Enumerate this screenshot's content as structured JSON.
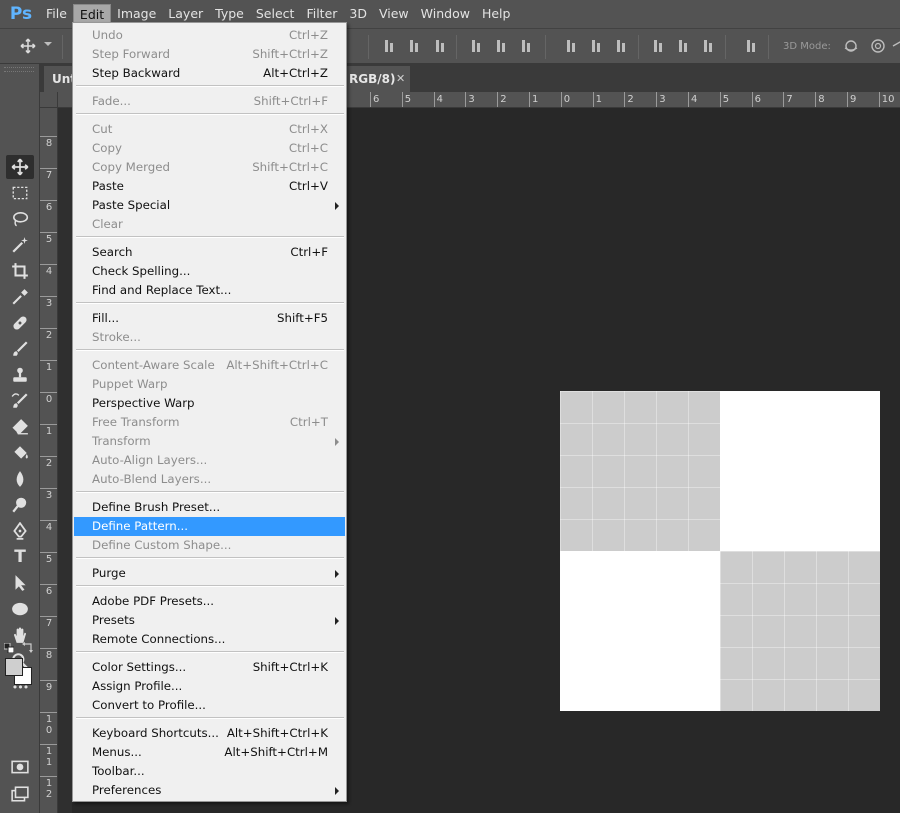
{
  "app": {
    "logo": "Ps"
  },
  "menubar": {
    "items": [
      "File",
      "Edit",
      "Image",
      "Layer",
      "Type",
      "Select",
      "Filter",
      "3D",
      "View",
      "Window",
      "Help"
    ],
    "active": "Edit"
  },
  "optionsbar": {
    "mode_3d_label": "3D Mode:",
    "icons": [
      "move-icon",
      "align-top-icon",
      "align-middle-icon",
      "align-bottom-icon",
      "align-left-icon",
      "align-center-icon",
      "align-right-icon",
      "distribute-icon",
      "3d-orbit-icon"
    ]
  },
  "document_tab": {
    "title_start": "Unt",
    "title_end": "RGB/8)",
    "close_glyph": "✕"
  },
  "rulers": {
    "top_ticks": [
      "6",
      "5",
      "4",
      "3",
      "2",
      "1",
      "0",
      "1",
      "2",
      "3",
      "4",
      "5",
      "6",
      "7",
      "8",
      "9",
      "10"
    ],
    "left_ticks": [
      "8",
      "7",
      "6",
      "5",
      "4",
      "3",
      "2",
      "1",
      "0",
      "1",
      "2",
      "3",
      "4",
      "5",
      "6",
      "7",
      "8",
      "9",
      "1\n0",
      "1\n1",
      "1\n2"
    ]
  },
  "toolbar": {
    "tools": [
      "move-tool",
      "marquee-tool",
      "lasso-tool",
      "magic-wand-tool",
      "crop-tool",
      "eyedropper-tool",
      "healing-brush-tool",
      "brush-tool",
      "clone-stamp-tool",
      "history-brush-tool",
      "eraser-tool",
      "paint-bucket-tool",
      "blur-tool",
      "dodge-tool",
      "pen-tool",
      "type-tool",
      "path-selection-tool",
      "ellipse-tool",
      "hand-tool",
      "zoom-tool",
      "more-tools",
      "quick-mask",
      "screen-mode"
    ],
    "type_glyph": "T",
    "more_glyph": "•••",
    "foreground_color": "#cfcfcf",
    "background_color": "#ffffff"
  },
  "edit_menu": {
    "groups": [
      [
        {
          "label": "Undo",
          "shortcut": "Ctrl+Z",
          "enabled": false
        },
        {
          "label": "Step Forward",
          "shortcut": "Shift+Ctrl+Z",
          "enabled": false
        },
        {
          "label": "Step Backward",
          "shortcut": "Alt+Ctrl+Z",
          "enabled": true
        }
      ],
      [
        {
          "label": "Fade...",
          "shortcut": "Shift+Ctrl+F",
          "enabled": false
        }
      ],
      [
        {
          "label": "Cut",
          "shortcut": "Ctrl+X",
          "enabled": false
        },
        {
          "label": "Copy",
          "shortcut": "Ctrl+C",
          "enabled": false
        },
        {
          "label": "Copy Merged",
          "shortcut": "Shift+Ctrl+C",
          "enabled": false
        },
        {
          "label": "Paste",
          "shortcut": "Ctrl+V",
          "enabled": true
        },
        {
          "label": "Paste Special",
          "shortcut": "",
          "enabled": true,
          "submenu": true
        },
        {
          "label": "Clear",
          "shortcut": "",
          "enabled": false
        }
      ],
      [
        {
          "label": "Search",
          "shortcut": "Ctrl+F",
          "enabled": true
        },
        {
          "label": "Check Spelling...",
          "shortcut": "",
          "enabled": true
        },
        {
          "label": "Find and Replace Text...",
          "shortcut": "",
          "enabled": true
        }
      ],
      [
        {
          "label": "Fill...",
          "shortcut": "Shift+F5",
          "enabled": true
        },
        {
          "label": "Stroke...",
          "shortcut": "",
          "enabled": false
        }
      ],
      [
        {
          "label": "Content-Aware Scale",
          "shortcut": "Alt+Shift+Ctrl+C",
          "enabled": false
        },
        {
          "label": "Puppet Warp",
          "shortcut": "",
          "enabled": false
        },
        {
          "label": "Perspective Warp",
          "shortcut": "",
          "enabled": true
        },
        {
          "label": "Free Transform",
          "shortcut": "Ctrl+T",
          "enabled": false
        },
        {
          "label": "Transform",
          "shortcut": "",
          "enabled": false,
          "submenu": true
        },
        {
          "label": "Auto-Align Layers...",
          "shortcut": "",
          "enabled": false
        },
        {
          "label": "Auto-Blend Layers...",
          "shortcut": "",
          "enabled": false
        }
      ],
      [
        {
          "label": "Define Brush Preset...",
          "shortcut": "",
          "enabled": true
        },
        {
          "label": "Define Pattern...",
          "shortcut": "",
          "enabled": true,
          "highlighted": true
        },
        {
          "label": "Define Custom Shape...",
          "shortcut": "",
          "enabled": false
        }
      ],
      [
        {
          "label": "Purge",
          "shortcut": "",
          "enabled": true,
          "submenu": true
        }
      ],
      [
        {
          "label": "Adobe PDF Presets...",
          "shortcut": "",
          "enabled": true
        },
        {
          "label": "Presets",
          "shortcut": "",
          "enabled": true,
          "submenu": true
        },
        {
          "label": "Remote Connections...",
          "shortcut": "",
          "enabled": true
        }
      ],
      [
        {
          "label": "Color Settings...",
          "shortcut": "Shift+Ctrl+K",
          "enabled": true
        },
        {
          "label": "Assign Profile...",
          "shortcut": "",
          "enabled": true
        },
        {
          "label": "Convert to Profile...",
          "shortcut": "",
          "enabled": true
        }
      ],
      [
        {
          "label": "Keyboard Shortcuts...",
          "shortcut": "Alt+Shift+Ctrl+K",
          "enabled": true
        },
        {
          "label": "Menus...",
          "shortcut": "Alt+Shift+Ctrl+M",
          "enabled": true
        },
        {
          "label": "Toolbar...",
          "shortcut": "",
          "enabled": true
        },
        {
          "label": "Preferences",
          "shortcut": "",
          "enabled": true,
          "submenu": true
        }
      ]
    ]
  },
  "canvas": {
    "pattern_colors": [
      "#cccccc",
      "#ffffff"
    ]
  }
}
